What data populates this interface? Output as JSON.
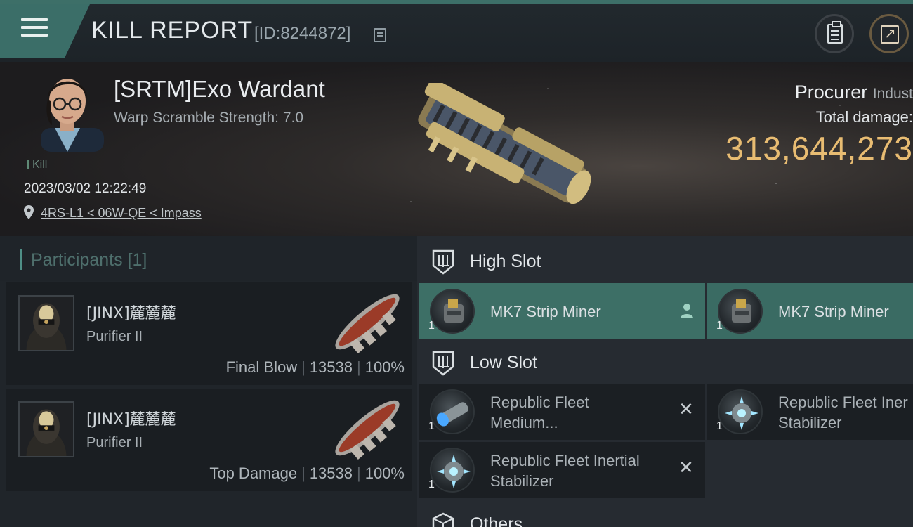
{
  "header": {
    "title": "KILL REPORT",
    "report_id": "[ID:8244872]"
  },
  "victim": {
    "name": "[SRTM]Exo Wardant",
    "subtitle": "Warp Scramble Strength: 7.0",
    "tag": "Kill",
    "datetime": "2023/03/02 12:22:49",
    "location": "4RS-L1 < 06W-QE < Impass",
    "ship_name": "Procurer",
    "ship_class": "Indust",
    "damage_label": "Total damage:",
    "damage_value": "313,644,273"
  },
  "participants": {
    "title": "Participants",
    "count": "[1]",
    "rows": [
      {
        "name": "[JINX]麓麓麓",
        "ship": "Purifier II",
        "role": "Final Blow",
        "damage": "13538",
        "percent": "100%"
      },
      {
        "name": "[JINX]麓麓麓",
        "ship": "Purifier II",
        "role": "Top Damage",
        "damage": "13538",
        "percent": "100%"
      }
    ]
  },
  "slots": {
    "high": {
      "label": "High Slot",
      "modules": [
        {
          "name": "MK7 Strip Miner",
          "qty": "1"
        },
        {
          "name": "MK7 Strip Miner",
          "qty": "1"
        }
      ]
    },
    "low": {
      "label": "Low Slot",
      "modules": [
        {
          "line1": "Republic Fleet",
          "line2": "Medium...",
          "qty": "1"
        },
        {
          "line1": "Republic Fleet Iner",
          "line2": "Stabilizer",
          "qty": "1"
        },
        {
          "line1": "Republic Fleet Inertial",
          "line2": "Stabilizer",
          "qty": "1"
        }
      ]
    },
    "others": {
      "label": "Others"
    }
  },
  "colors": {
    "accent_teal": "#3d6f66",
    "damage_gold": "#e8bc72"
  },
  "icons": [
    "menu-icon",
    "copy-icon",
    "clipboard-icon",
    "share-icon",
    "location-pin-icon",
    "high-slot-icon",
    "low-slot-icon",
    "others-icon",
    "person-icon",
    "close-icon"
  ]
}
